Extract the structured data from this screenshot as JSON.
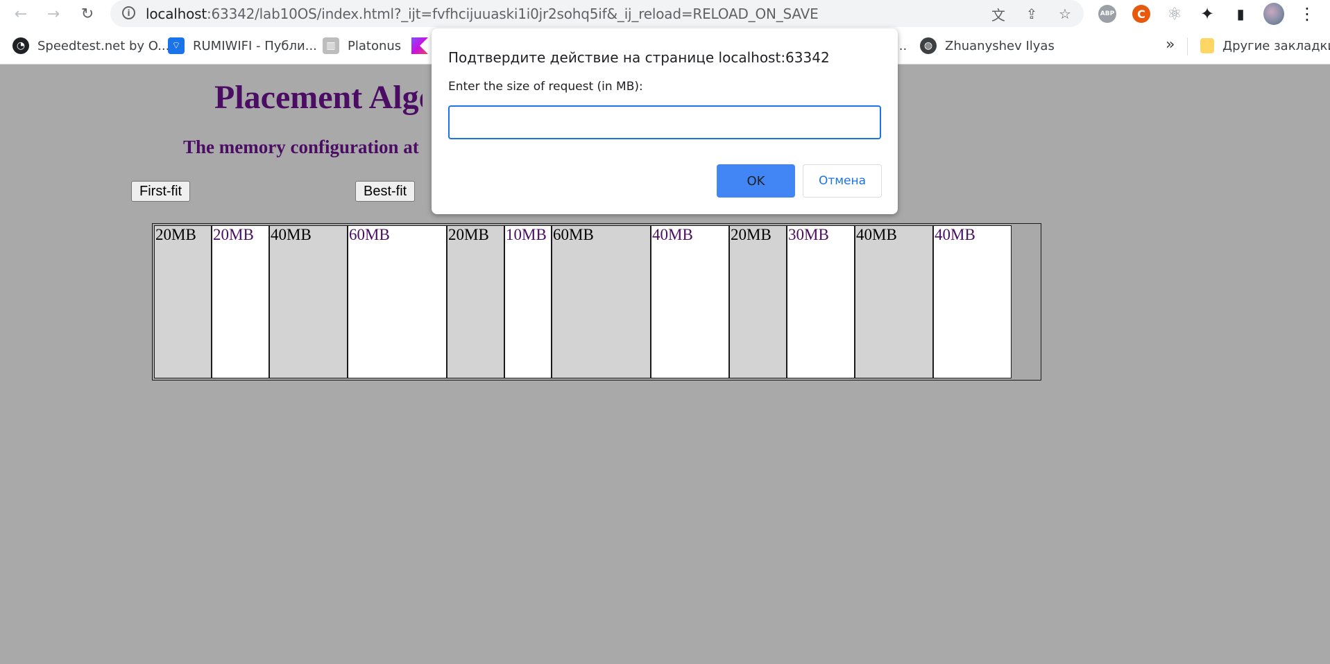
{
  "browser": {
    "url_host": "localhost",
    "url_path": ":63342/lab10OS/index.html?_ijt=fvfhcijuuaski1i0jr2sohq5if&_ij_reload=RELOAD_ON_SAVE",
    "icons": {
      "back": "←",
      "forward": "→",
      "reload": "↻",
      "info": "i",
      "translate": "文",
      "share": "⇪",
      "star": "☆",
      "extensions": "✦",
      "sidebar": "▮",
      "menu": "⋮",
      "react": "⚛"
    },
    "abp_label": "ABP",
    "c_ext_label": "C"
  },
  "bookmarks": {
    "items": [
      {
        "label": "Speedtest.net by O...",
        "icon": "◔"
      },
      {
        "label": "RUMIWIFI - Публи...",
        "icon": "⌔"
      },
      {
        "label": "Platonus",
        "icon": "▥"
      },
      {
        "label": "...",
        "icon": ""
      },
      {
        "label": "Zhuanyshev Ilyas",
        "icon": "◍"
      }
    ],
    "more": "»",
    "other": "Другие закладки"
  },
  "page": {
    "title": "Placement Algorithms",
    "subtitle": "The memory configuration at",
    "buttons": {
      "first_fit": "First-fit",
      "best_fit": "Best-fit"
    },
    "memory_blocks": [
      {
        "label": "20MB",
        "state": "occupied"
      },
      {
        "label": "20MB",
        "state": "free"
      },
      {
        "label": "40MB",
        "state": "occupied"
      },
      {
        "label": "60MB",
        "state": "free"
      },
      {
        "label": "20MB",
        "state": "occupied"
      },
      {
        "label": "10MB",
        "state": "free"
      },
      {
        "label": "60MB",
        "state": "occupied"
      },
      {
        "label": "40MB",
        "state": "free"
      },
      {
        "label": "20MB",
        "state": "occupied"
      },
      {
        "label": "30MB",
        "state": "free"
      },
      {
        "label": "40MB",
        "state": "occupied"
      },
      {
        "label": "40MB",
        "state": "free"
      }
    ]
  },
  "dialog": {
    "title": "Подтвердите действие на странице localhost:63342",
    "message": "Enter the size of request (in MB):",
    "input_value": "",
    "ok_label": "OK",
    "cancel_label": "Отмена"
  }
}
